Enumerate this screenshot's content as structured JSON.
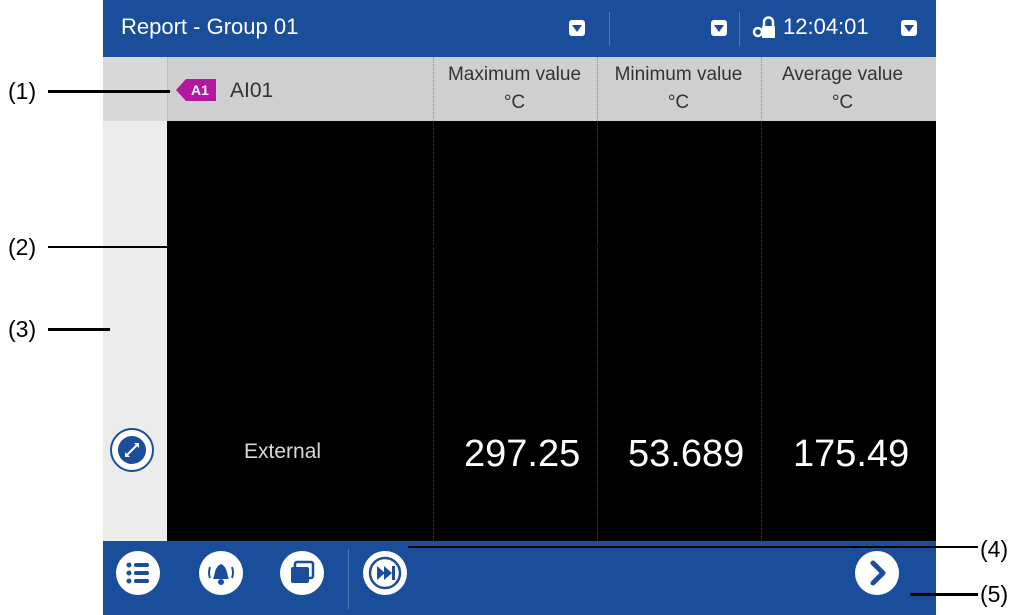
{
  "titlebar": {
    "title": "Report - Group 01",
    "time": "12:04:01"
  },
  "header": {
    "tag": "A1",
    "channel": "AI01",
    "columns": [
      {
        "name": "Maximum value",
        "unit": "°C"
      },
      {
        "name": "Minimum value",
        "unit": "°C"
      },
      {
        "name": "Average value",
        "unit": "°C"
      }
    ]
  },
  "row": {
    "label": "External",
    "values": [
      "297.25",
      "53.689",
      "175.49"
    ]
  },
  "callouts": [
    "(1)",
    "(2)",
    "(3)",
    "(4)",
    "(5)"
  ],
  "colors": {
    "accent": "#1a4d9a",
    "tag": "#b3179e",
    "background": "#000000"
  }
}
